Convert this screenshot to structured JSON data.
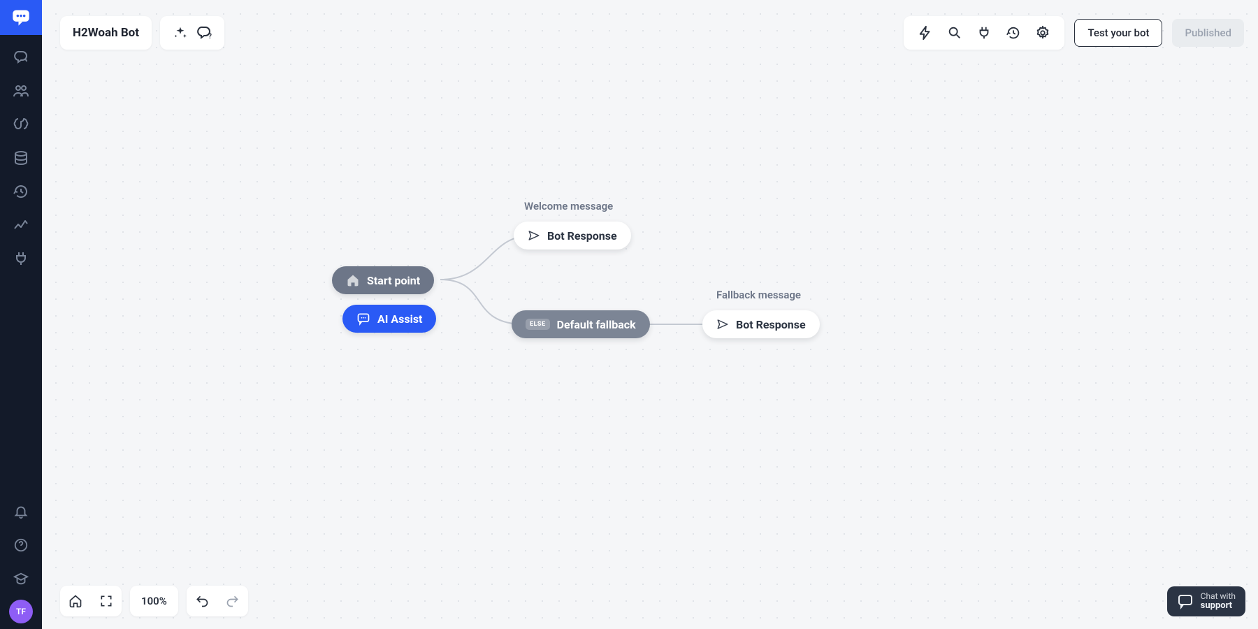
{
  "bot": {
    "name": "H2Woah Bot"
  },
  "header": {
    "buttons": {
      "test": "Test your bot",
      "published": "Published"
    },
    "toolbar_icons": [
      "bolt",
      "search",
      "plug",
      "history",
      "gear"
    ]
  },
  "sidebar": {
    "nav_icons": [
      "chat-flow",
      "users",
      "brain",
      "database",
      "history",
      "analytics",
      "plug"
    ],
    "bottom_icons": [
      "bell",
      "help",
      "academy"
    ],
    "avatar_initials": "TF"
  },
  "canvas": {
    "labels": {
      "welcome": "Welcome message",
      "fallback": "Fallback message"
    },
    "nodes": {
      "start": "Start point",
      "ai_assist": "AI Assist",
      "welcome_resp": "Bot Response",
      "default_fallback": "Default fallback",
      "default_fallback_badge": "ELSE",
      "fallback_resp": "Bot Response"
    }
  },
  "zoom": {
    "percent": "100%"
  },
  "support": {
    "line1": "Chat with",
    "line2": "support"
  }
}
